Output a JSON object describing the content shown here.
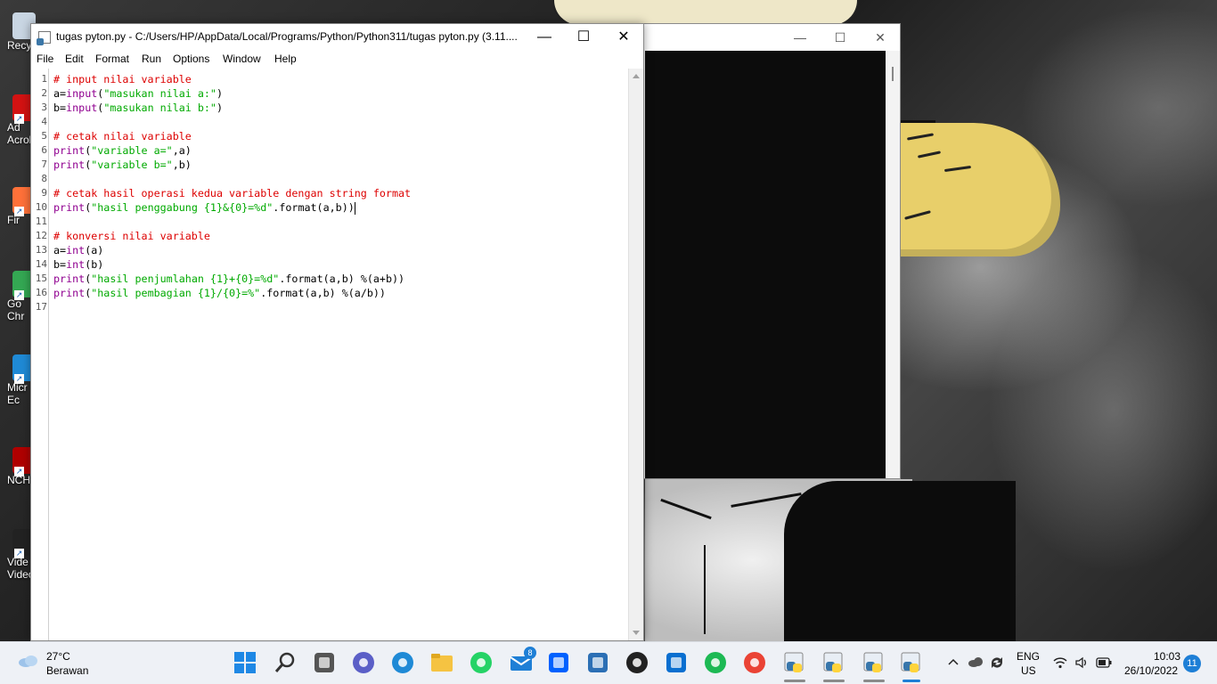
{
  "editor": {
    "title": "tugas pyton.py - C:/Users/HP/AppData/Local/Programs/Python/Python311/tugas pyton.py (3.11....",
    "menu": [
      "File",
      "Edit",
      "Format",
      "Run",
      "Options",
      "Window",
      "Help"
    ],
    "buttons": {
      "minimize": "—",
      "maximize": "☐",
      "close": "✕"
    },
    "lines": [
      {
        "n": "1",
        "tokens": [
          {
            "t": "# input nilai variable",
            "c": "comment"
          }
        ]
      },
      {
        "n": "2",
        "tokens": [
          {
            "t": "a=",
            "c": "plain"
          },
          {
            "t": "input",
            "c": "builtin"
          },
          {
            "t": "(",
            "c": "plain"
          },
          {
            "t": "\"masukan nilai a:\"",
            "c": "string"
          },
          {
            "t": ")",
            "c": "plain"
          }
        ]
      },
      {
        "n": "3",
        "tokens": [
          {
            "t": "b=",
            "c": "plain"
          },
          {
            "t": "input",
            "c": "builtin"
          },
          {
            "t": "(",
            "c": "plain"
          },
          {
            "t": "\"masukan nilai b:\"",
            "c": "string"
          },
          {
            "t": ")",
            "c": "plain"
          }
        ]
      },
      {
        "n": "4",
        "tokens": []
      },
      {
        "n": "5",
        "tokens": [
          {
            "t": "# cetak nilai variable",
            "c": "comment"
          }
        ]
      },
      {
        "n": "6",
        "tokens": [
          {
            "t": "print",
            "c": "builtin"
          },
          {
            "t": "(",
            "c": "plain"
          },
          {
            "t": "\"variable a=\"",
            "c": "string"
          },
          {
            "t": ",a)",
            "c": "plain"
          }
        ]
      },
      {
        "n": "7",
        "tokens": [
          {
            "t": "print",
            "c": "builtin"
          },
          {
            "t": "(",
            "c": "plain"
          },
          {
            "t": "\"variable b=\"",
            "c": "string"
          },
          {
            "t": ",b)",
            "c": "plain"
          }
        ]
      },
      {
        "n": "8",
        "tokens": []
      },
      {
        "n": "9",
        "tokens": [
          {
            "t": "# cetak hasil operasi kedua variable dengan string format",
            "c": "comment"
          }
        ]
      },
      {
        "n": "10",
        "tokens": [
          {
            "t": "print",
            "c": "builtin"
          },
          {
            "t": "(",
            "c": "plain"
          },
          {
            "t": "\"hasil penggabung {1}&{0}=%d\"",
            "c": "string"
          },
          {
            "t": ".format(a,b))",
            "c": "plain"
          }
        ],
        "cursor": true
      },
      {
        "n": "11",
        "tokens": []
      },
      {
        "n": "12",
        "tokens": [
          {
            "t": "# konversi nilai variable",
            "c": "comment"
          }
        ]
      },
      {
        "n": "13",
        "tokens": [
          {
            "t": "a=",
            "c": "plain"
          },
          {
            "t": "int",
            "c": "builtin"
          },
          {
            "t": "(a)",
            "c": "plain"
          }
        ]
      },
      {
        "n": "14",
        "tokens": [
          {
            "t": "b=",
            "c": "plain"
          },
          {
            "t": "int",
            "c": "builtin"
          },
          {
            "t": "(b)",
            "c": "plain"
          }
        ]
      },
      {
        "n": "15",
        "tokens": [
          {
            "t": "print",
            "c": "builtin"
          },
          {
            "t": "(",
            "c": "plain"
          },
          {
            "t": "\"hasil penjumlahan {1}+{0}=%d\"",
            "c": "string"
          },
          {
            "t": ".format(a,b) %(a+b))",
            "c": "plain"
          }
        ]
      },
      {
        "n": "16",
        "tokens": [
          {
            "t": "print",
            "c": "builtin"
          },
          {
            "t": "(",
            "c": "plain"
          },
          {
            "t": "\"hasil pembagian {1}/{0}=%\"",
            "c": "string"
          },
          {
            "t": ".format(a,b) %(a/b))",
            "c": "plain"
          }
        ]
      },
      {
        "n": "17",
        "tokens": []
      }
    ]
  },
  "console": {
    "buttons": {
      "minimize": "—",
      "maximize": "☐",
      "close": "✕"
    }
  },
  "desktop": {
    "icons": [
      {
        "label": "Recy",
        "icon": "recycle-bin-icon",
        "color": "#c9d6e3"
      },
      {
        "label": "Ad\nAcrob",
        "icon": "acrobat-icon",
        "color": "#d31212"
      },
      {
        "label": "Fir",
        "icon": "firefox-icon",
        "color": "#ff7139"
      },
      {
        "label": "Go\nChr",
        "icon": "chrome-icon",
        "color": "#34a853"
      },
      {
        "label": "Micr\nEc",
        "icon": "edge-icon",
        "color": "#1f8ad6"
      },
      {
        "label": "NCH",
        "icon": "nch-icon",
        "color": "#b00000"
      },
      {
        "label": "Vide\nVideo",
        "icon": "video-icon",
        "color": "#222222"
      }
    ]
  },
  "taskbar": {
    "weather": {
      "temp": "27°C",
      "desc": "Berawan"
    },
    "apps": [
      {
        "name": "start",
        "icon": "windows-start-icon",
        "color": "#1e88e5"
      },
      {
        "name": "search",
        "icon": "search-icon",
        "color": "#333333"
      },
      {
        "name": "task-view",
        "icon": "task-view-icon",
        "color": "#555555"
      },
      {
        "name": "meet",
        "icon": "meet-icon",
        "color": "#5b5fc7"
      },
      {
        "name": "edge",
        "icon": "edge-icon",
        "color": "#1f8ad6"
      },
      {
        "name": "explorer",
        "icon": "folder-icon",
        "color": "#f5c342"
      },
      {
        "name": "whatsapp",
        "icon": "whatsapp-icon",
        "color": "#25d366"
      },
      {
        "name": "mail",
        "icon": "mail-icon",
        "color": "#1e7fd6",
        "badge": "8"
      },
      {
        "name": "dropbox",
        "icon": "dropbox-icon",
        "color": "#0061fe"
      },
      {
        "name": "news",
        "icon": "news-icon",
        "color": "#2b6fb5"
      },
      {
        "name": "app-dark",
        "icon": "shield-app-icon",
        "color": "#222222"
      },
      {
        "name": "hp",
        "icon": "hp-icon",
        "color": "#0a6fd0"
      },
      {
        "name": "spotify",
        "icon": "spotify-icon",
        "color": "#1db954"
      },
      {
        "name": "chrome",
        "icon": "chrome-icon",
        "color": "#ea4335"
      },
      {
        "name": "python-idle-1",
        "icon": "python-icon",
        "color": "#3776ab"
      },
      {
        "name": "python-idle-2",
        "icon": "python-icon",
        "color": "#3776ab"
      },
      {
        "name": "python-launcher",
        "icon": "python-window-icon",
        "color": "#3776ab"
      },
      {
        "name": "python-active",
        "icon": "python-file-icon",
        "color": "#3776ab"
      }
    ],
    "tray": {
      "lang_top": "ENG",
      "lang_bottom": "US"
    },
    "clock": {
      "time": "10:03",
      "date": "26/10/2022"
    },
    "notifications": "11"
  }
}
